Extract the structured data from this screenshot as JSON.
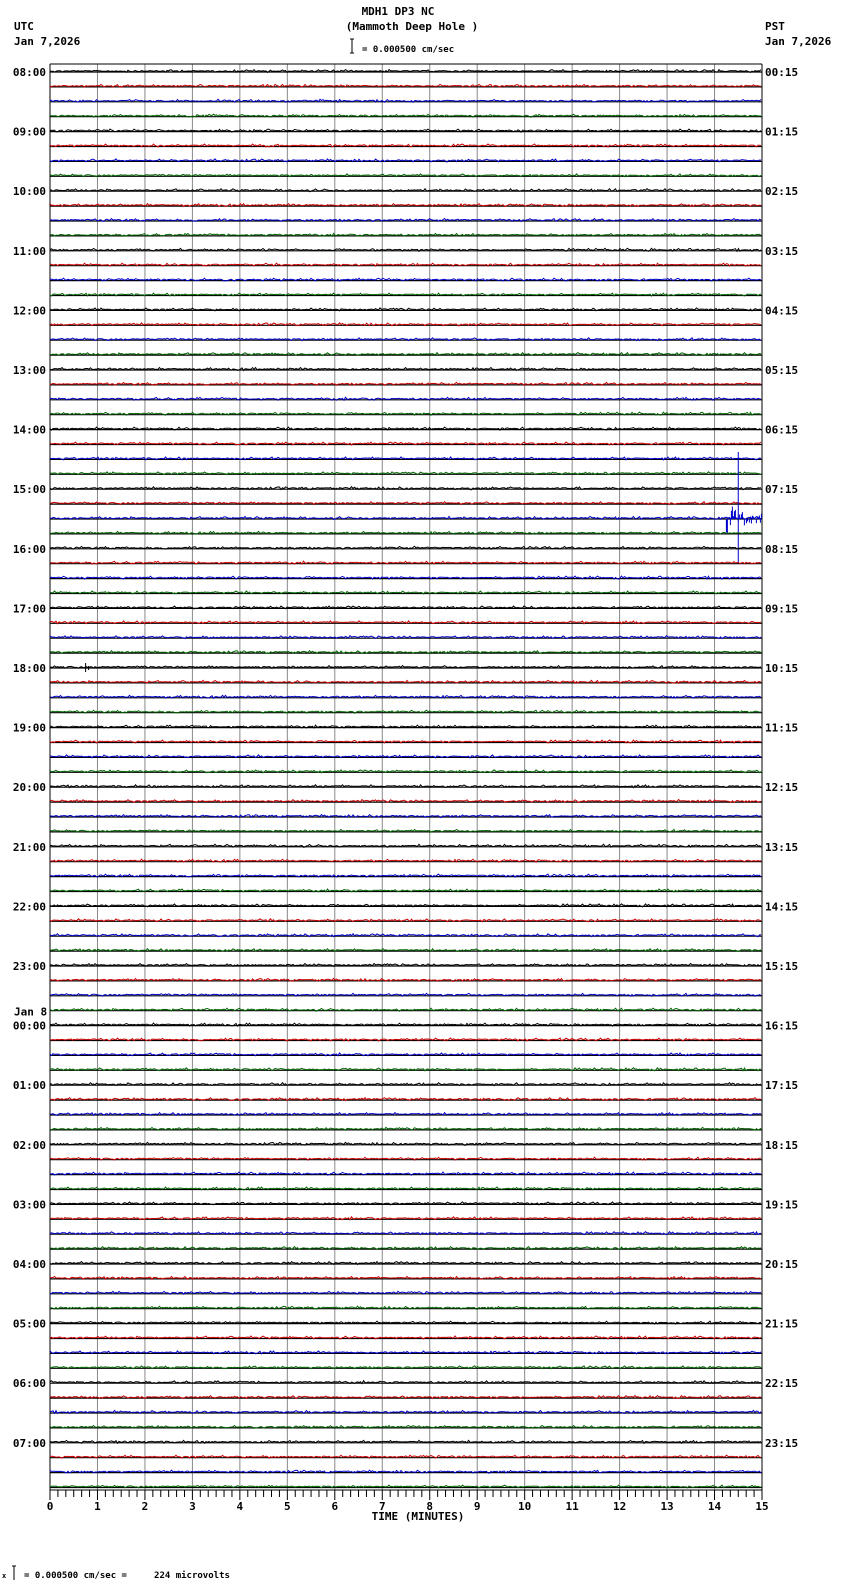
{
  "chart_data": {
    "type": "line",
    "subtype": "helicorder",
    "title": "MDH1 DP3 NC",
    "subtitle": "(Mammoth Deep Hole )",
    "left_zone": "UTC",
    "left_date": "Jan 7,2026",
    "right_zone": "PST",
    "right_date": "Jan 7,2026",
    "scale_label": "= 0.000500 cm/sec",
    "footer_scale": "= 0.000500 cm/sec =     224 microvolts",
    "footer_mark": "x",
    "xlabel": "TIME (MINUTES)",
    "xlim": [
      0,
      15
    ],
    "xticks": [
      "0",
      "1",
      "2",
      "3",
      "4",
      "5",
      "6",
      "7",
      "8",
      "9",
      "10",
      "11",
      "12",
      "13",
      "14",
      "15"
    ],
    "rows_per_hour": 4,
    "trace_colors": [
      "#000000",
      "#cc0000",
      "#0000cc",
      "#006600"
    ],
    "left_labels": [
      "08:00",
      "09:00",
      "10:00",
      "11:00",
      "12:00",
      "13:00",
      "14:00",
      "15:00",
      "16:00",
      "17:00",
      "18:00",
      "19:00",
      "20:00",
      "21:00",
      "22:00",
      "23:00",
      "00:00",
      "01:00",
      "02:00",
      "03:00",
      "04:00",
      "05:00",
      "06:00",
      "07:00"
    ],
    "date_change": {
      "hour_index": 16,
      "label": "Jan 8"
    },
    "right_labels": [
      "00:15",
      "01:15",
      "02:15",
      "03:15",
      "04:15",
      "05:15",
      "06:15",
      "07:15",
      "08:15",
      "09:15",
      "10:15",
      "11:15",
      "12:15",
      "13:15",
      "14:15",
      "15:15",
      "16:15",
      "17:15",
      "18:15",
      "19:15",
      "20:15",
      "21:15",
      "22:15",
      "23:15"
    ],
    "events": [
      {
        "row": 30,
        "minute": 14.5,
        "type": "earthquake",
        "duration_min": 0.5
      },
      {
        "row": 40,
        "minute": 0.75,
        "type": "small",
        "duration_min": 0.1
      }
    ]
  }
}
